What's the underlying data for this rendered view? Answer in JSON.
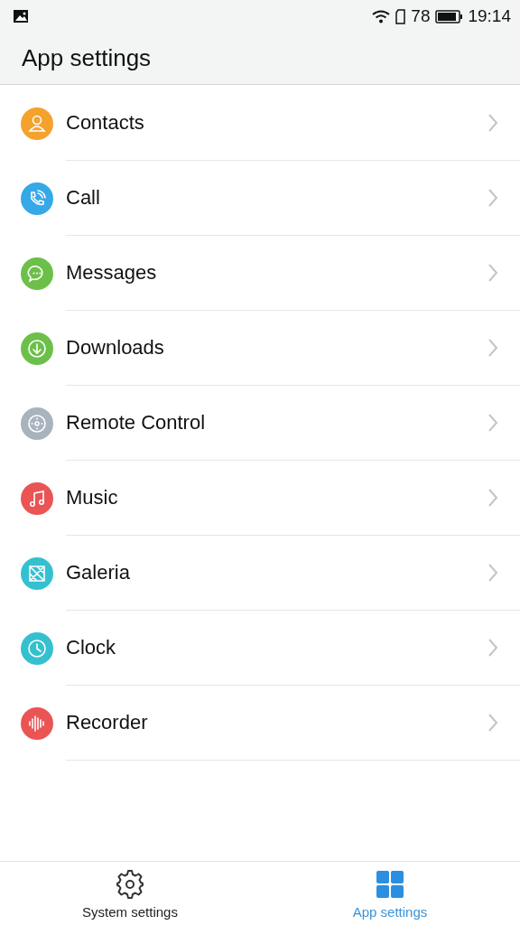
{
  "status_bar": {
    "battery_text": "78",
    "time": "19:14"
  },
  "header": {
    "title": "App settings"
  },
  "items": [
    {
      "label": "Contacts",
      "kind": "person",
      "color": "#f5a22d"
    },
    {
      "label": "Call",
      "kind": "phone",
      "color": "#35a8e8"
    },
    {
      "label": "Messages",
      "kind": "chat",
      "color": "#6cc04a"
    },
    {
      "label": "Downloads",
      "kind": "download",
      "color": "#6cc04a"
    },
    {
      "label": "Remote Control",
      "kind": "remote",
      "color": "#a7b3bd"
    },
    {
      "label": "Music",
      "kind": "music",
      "color": "#ea5455"
    },
    {
      "label": "Galeria",
      "kind": "pinwheel",
      "color": "#35c0d0"
    },
    {
      "label": "Clock",
      "kind": "clock",
      "color": "#35c0d0"
    },
    {
      "label": "Recorder",
      "kind": "wave",
      "color": "#ea5455"
    }
  ],
  "tabs": [
    {
      "label": "System settings",
      "kind": "gear",
      "selected": false
    },
    {
      "label": "App settings",
      "kind": "grid",
      "selected": true
    }
  ]
}
